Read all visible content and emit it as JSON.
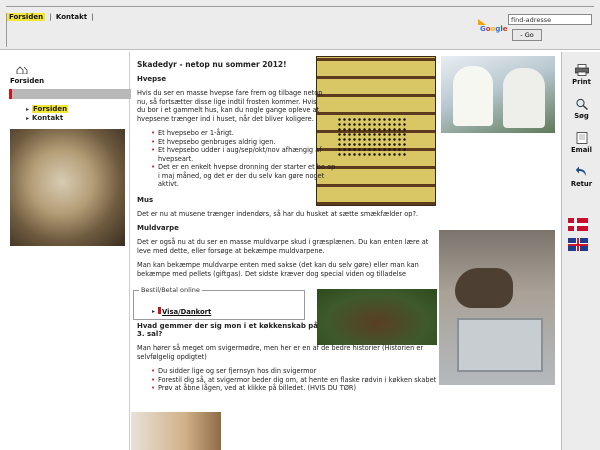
{
  "nav": {
    "items": [
      {
        "label": "Forsiden",
        "active": true
      },
      {
        "label": "Kontakt",
        "active": false
      }
    ],
    "separator": "|"
  },
  "search": {
    "brand": "Google",
    "placeholder": "find-adresse",
    "value": "find-adresse",
    "button_label": "- Go"
  },
  "sidebar": {
    "home_label": "Forsiden",
    "menu": [
      {
        "label": "Forsiden",
        "active": true
      },
      {
        "label": "Kontakt",
        "active": false
      }
    ]
  },
  "content": {
    "page_title": "Skadedyr - netop nu sommer 2012!",
    "sections": [
      {
        "title": "Hvepse",
        "paragraphs": [
          "Hvis du ser en masse hvepse fare frem og tilbage netop nu, så fortsætter disse lige indtil frosten kommer. Hvis du bor i et gammelt hus, kan du nogle gange opleve at hvepsene trænger ind i huset, når det bliver koligere."
        ],
        "bullets": [
          "Et hvepsebo er 1-årigt.",
          "Et hvepsebo genbruges aldrig igen.",
          "Et hvepsebo udder i aug/sep/okt/nov afhængig af hvepseart.",
          "Det er en enkelt hvepse dronning der starter et bo op i maj måned, og det er der du selv kan gøre noget aktivt."
        ]
      },
      {
        "title": "Mus",
        "paragraphs": [
          "Det er nu at musene trænger indendørs, så har du husket at sætte smækfælder op?."
        ]
      },
      {
        "title": "Muldvarpe",
        "paragraphs": [
          "Det er også nu at du ser en masse muldvarpe skud i græsplænen. Du kan enten lære at leve med dette, eller forsøge at bekæmpe muldvarpene.",
          "Man kan bekæmpe muldvarpe enten med sakse (det kan du selv gøre) eller man kan bekæmpe med pellets (giftgas). Det sidste kræver dog special viden og tilladelse"
        ]
      },
      {
        "title": "Hvad gemmer der sig mon i et køkkenskab på 3. sal?",
        "paragraphs": [
          "Man hører så meget om svigermødre, men her er en af de bedre historier (Historien er selvfølgelig opdigtet)"
        ],
        "bullets": [
          "Du sidder lige og ser fjernsyn hos din svigermor",
          "Forestil dig så, at svigermor beder dig om, at hente en flaske rødvin i køkken skabet",
          "Prøv at åbne lågen, ved at klikke på billedet. (HVIS DU TØR)"
        ]
      }
    ]
  },
  "payment": {
    "legend": "Bestil/Betal online",
    "link": "Visa/Dankort"
  },
  "tools": {
    "print": "Print",
    "search": "Søg",
    "email": "Email",
    "back": "Retur"
  },
  "colors": {
    "active_highlight": "#f3e634",
    "menu_bar": "#b8b8b8",
    "accent_red": "#d21414",
    "chrome_grey": "#ececec"
  },
  "icons": [
    "home-icon",
    "printer-icon",
    "magnifier-icon",
    "email-icon",
    "back-arrow-icon",
    "danish-flag-icon",
    "uk-flag-icon"
  ]
}
